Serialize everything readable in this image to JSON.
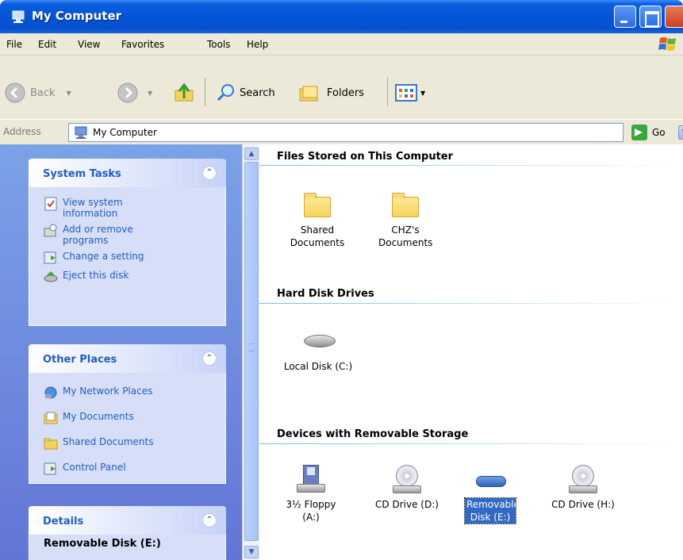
{
  "window": {
    "title": "My Computer"
  },
  "menu": [
    "File",
    "Edit",
    "View",
    "Favorites",
    "Tools",
    "Help"
  ],
  "toolbar": {
    "back": "Back",
    "search": "Search",
    "folders": "Folders"
  },
  "address": {
    "label": "Address",
    "value": "My Computer",
    "go": "Go"
  },
  "system_tasks": {
    "title": "System Tasks",
    "items": [
      "View system information",
      "Add or remove programs",
      "Change a setting",
      "Eject this disk"
    ]
  },
  "other_places": {
    "title": "Other Places",
    "items": [
      "My Network Places",
      "My Documents",
      "Shared Documents",
      "Control Panel"
    ]
  },
  "details": {
    "title": "Details",
    "selected_name": "Removable Disk (E:)"
  },
  "groups": {
    "files": {
      "title": "Files Stored on This Computer",
      "items": [
        "Shared Documents",
        "CHZ's Documents"
      ]
    },
    "hard_disks": {
      "title": "Hard Disk Drives",
      "items": [
        "Local Disk (C:)"
      ]
    },
    "removable": {
      "title": "Devices with Removable Storage",
      "items": [
        "3½ Floppy (A:)",
        "CD Drive (D:)",
        "Removable Disk (E:)",
        "CD Drive (H:)"
      ]
    }
  },
  "colors": {
    "titlebar": "#0454d6",
    "taskpane": "#7ba2e7",
    "link": "#215dc6",
    "selection": "#316ac5"
  }
}
